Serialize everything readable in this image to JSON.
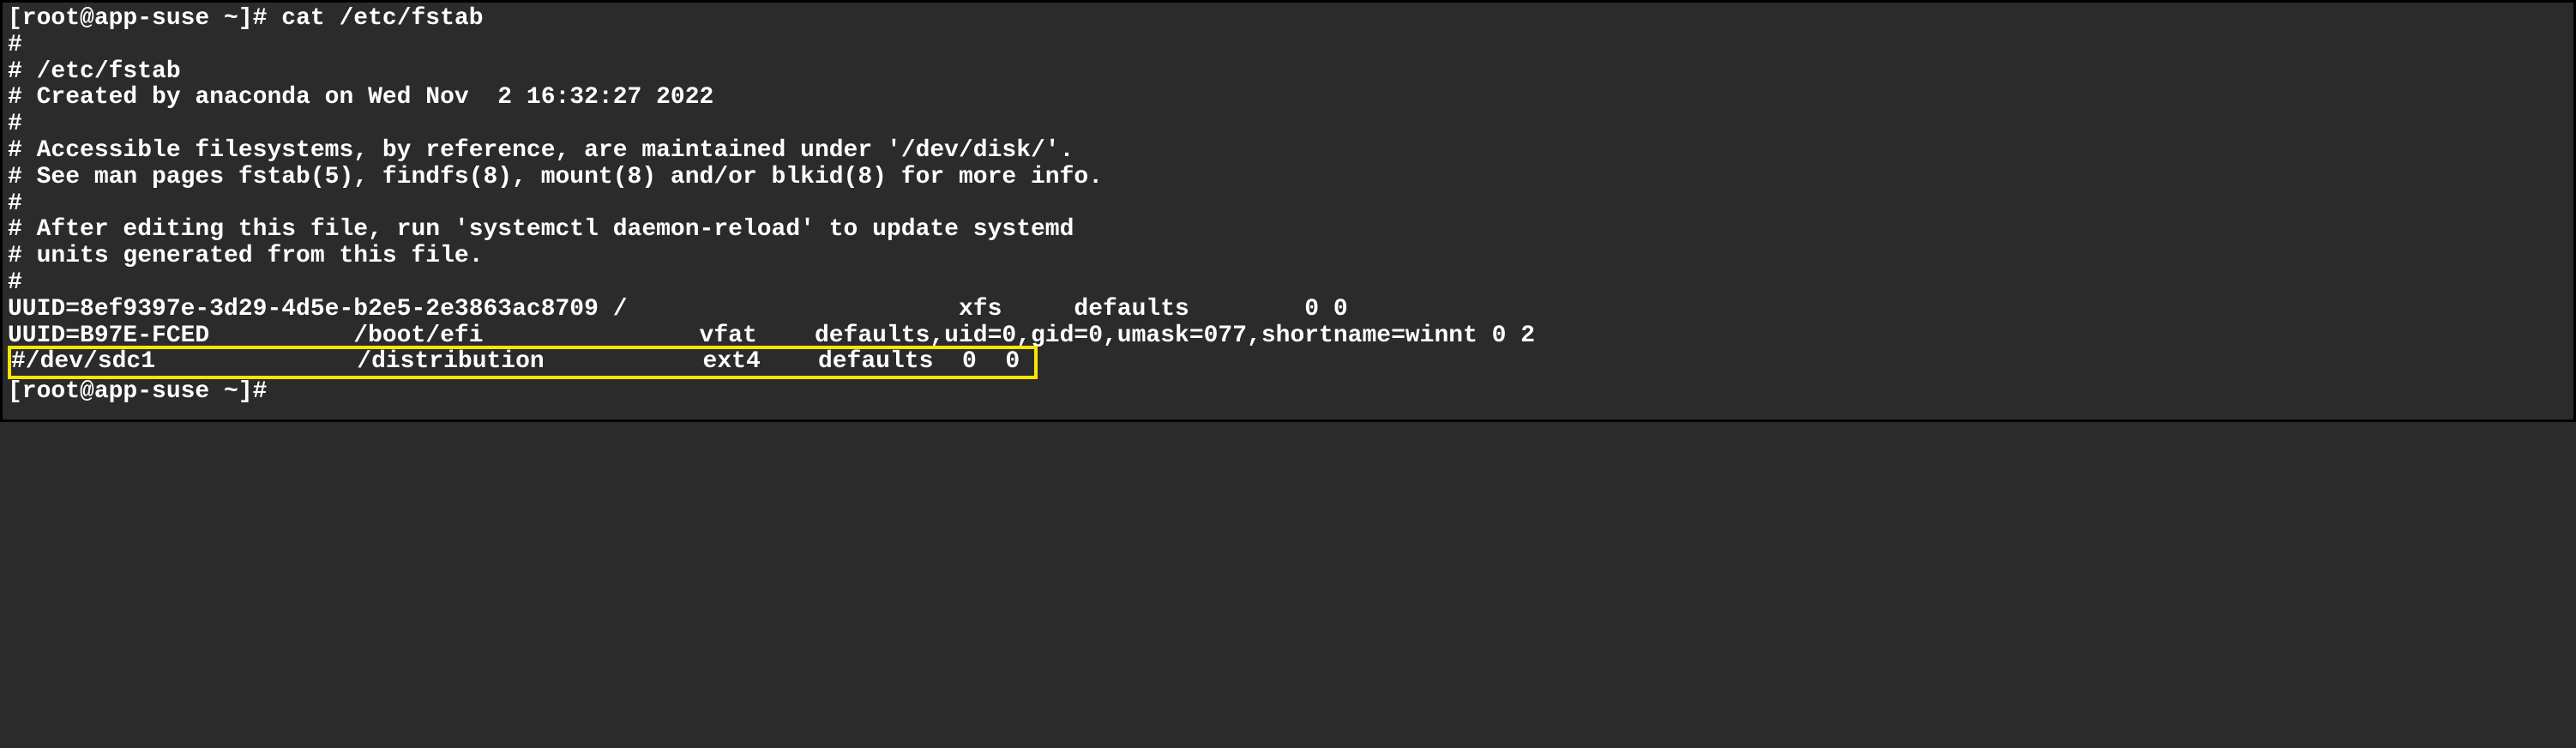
{
  "terminal": {
    "prompt": "[root@app-suse ~]# ",
    "command": "cat /etc/fstab",
    "end_prompt": "[root@app-suse ~]#"
  },
  "file_lines": [
    "",
    "#",
    "# /etc/fstab",
    "# Created by anaconda on Wed Nov  2 16:32:27 2022",
    "#",
    "# Accessible filesystems, by reference, are maintained under '/dev/disk/'.",
    "# See man pages fstab(5), findfs(8), mount(8) and/or blkid(8) for more info.",
    "#",
    "# After editing this file, run 'systemctl daemon-reload' to update systemd",
    "# units generated from this file.",
    "#"
  ],
  "fstab_entries": [
    "UUID=8ef9397e-3d29-4d5e-b2e5-2e3863ac8709 /                       xfs     defaults        0 0",
    "UUID=B97E-FCED          /boot/efi               vfat    defaults,uid=0,gid=0,umask=077,shortname=winnt 0 2"
  ],
  "highlighted_entry": "#/dev/sdc1              /distribution           ext4    defaults  0  0 "
}
